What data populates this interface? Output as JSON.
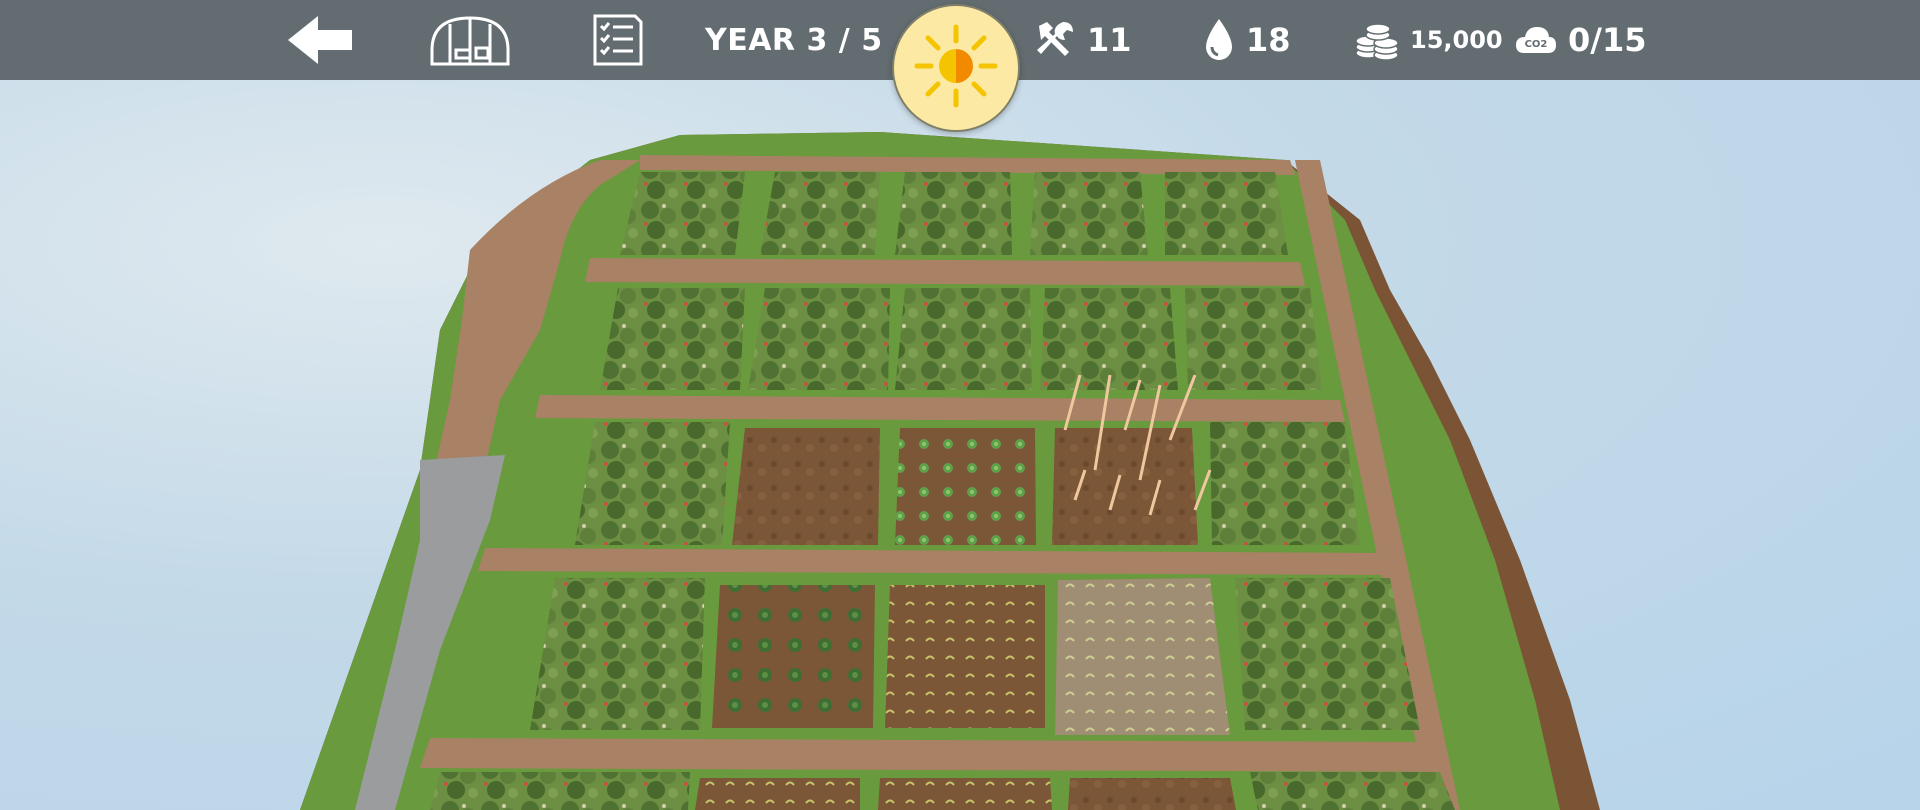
{
  "hud": {
    "year_text": "YEAR 3 / 5",
    "tools_count": "11",
    "water_count": "18",
    "money": "15,000",
    "co2_progress": "0/15",
    "co2_icon_label": "CO2"
  },
  "icons": {
    "back": "back-arrow-icon",
    "greenhouse": "greenhouse-icon",
    "checklist": "checklist-icon",
    "sun": "sun-icon",
    "tools": "tools-icon",
    "water": "water-drop-icon",
    "coins": "coins-icon",
    "co2": "co2-cloud-icon"
  },
  "colors": {
    "hud_bar": "#636c70",
    "sun_button": "#fbe9a4",
    "grass": "#6a9a3e",
    "path": "#a98165",
    "soil": "#7a5536",
    "road": "#9a9c9e"
  },
  "garden": {
    "rows": [
      {
        "plots": [
          "tree-cluster",
          "tree-cluster",
          "tree-cluster",
          "tree-cluster",
          "tree-cluster"
        ]
      },
      {
        "plots": [
          "tree-cluster",
          "tree-cluster",
          "tree-cluster",
          "tree-cluster",
          "tree-cluster"
        ]
      },
      {
        "plots": [
          "tree-cluster",
          "bare-soil",
          "lettuce",
          "bean-stakes",
          "tree-cluster"
        ]
      },
      {
        "plots": [
          "tree-cluster",
          "cabbage",
          "seedlings",
          "seedlings-covered",
          "tree-cluster"
        ]
      }
    ]
  }
}
